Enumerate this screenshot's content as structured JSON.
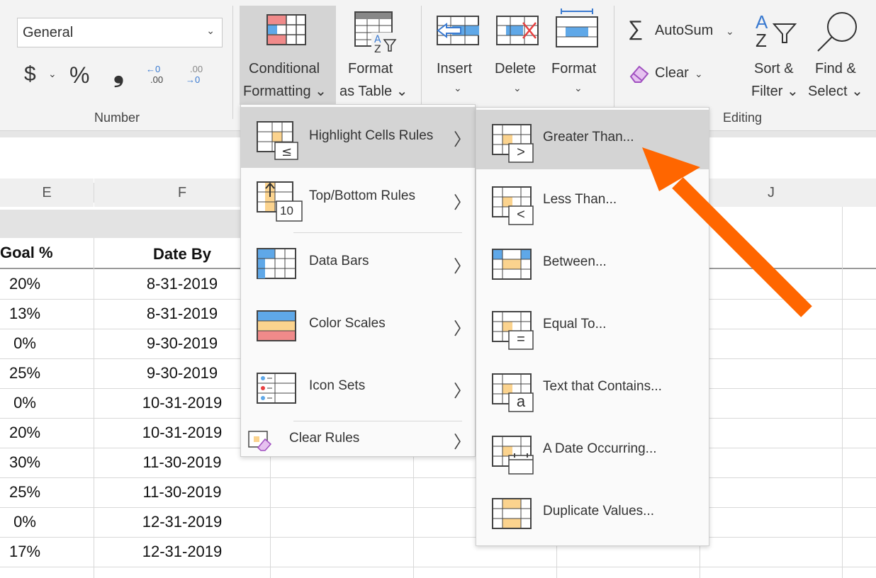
{
  "ribbon": {
    "number_format": "General",
    "currency_symbol": "$",
    "percent_symbol": "%",
    "comma_symbol": "❟",
    "inc_decimal_top": "←0",
    "inc_decimal_bottom": ".00",
    "dec_decimal_top": ".00",
    "dec_decimal_bottom": "→0",
    "number_group_label": "Number",
    "cf_label_1": "Conditional",
    "cf_label_2": "Formatting ⌄",
    "fat_label_1": "Format",
    "fat_label_2": "as Table ⌄",
    "insert_label": "Insert",
    "delete_label": "Delete",
    "format_label": "Format",
    "autosum_label": "AutoSum",
    "clear_label": "Clear",
    "sort_label_1": "Sort &",
    "sort_label_2": "Filter ⌄",
    "find_label_1": "Find &",
    "find_label_2": "Select ⌄",
    "editing_group_label": "Editing",
    "sigma": "∑",
    "az": "A",
    "za": "Z",
    "dropdown_glyph": "⌄"
  },
  "sheet": {
    "col_e": "E",
    "col_f": "F",
    "col_j": "J",
    "header_goal": "Goal %",
    "header_date": "Date By",
    "rows": [
      {
        "goal": "20%",
        "date": "8-31-2019"
      },
      {
        "goal": "13%",
        "date": "8-31-2019"
      },
      {
        "goal": "0%",
        "date": "9-30-2019"
      },
      {
        "goal": "25%",
        "date": "9-30-2019"
      },
      {
        "goal": "0%",
        "date": "10-31-2019"
      },
      {
        "goal": "20%",
        "date": "10-31-2019"
      },
      {
        "goal": "30%",
        "date": "11-30-2019"
      },
      {
        "goal": "25%",
        "date": "11-30-2019"
      },
      {
        "goal": "0%",
        "date": "12-31-2019"
      },
      {
        "goal": "17%",
        "date": "12-31-2019"
      }
    ]
  },
  "menu1": {
    "items": [
      {
        "label": "Highlight Cells Rules"
      },
      {
        "label": "Top/Bottom Rules"
      },
      {
        "label": "Data Bars"
      },
      {
        "label": "Color Scales"
      },
      {
        "label": "Icon Sets"
      },
      {
        "label": "Clear Rules"
      }
    ],
    "arrow": "〉",
    "topbottom_badge": "10"
  },
  "menu2": {
    "items": [
      {
        "label": "Greater Than..."
      },
      {
        "label": "Less Than..."
      },
      {
        "label": "Between..."
      },
      {
        "label": "Equal To..."
      },
      {
        "label": "Text that Contains..."
      },
      {
        "label": "A Date Occurring..."
      },
      {
        "label": "Duplicate Values..."
      }
    ],
    "badges": [
      ">",
      "<",
      "",
      "=",
      "a",
      "",
      ""
    ]
  },
  "colors": {
    "arrow": "#ff6600",
    "highlight": "#d4d4d4",
    "icon_yellow": "#fbd38e",
    "icon_red": "#f08a8a",
    "icon_blue": "#5fa8e8",
    "clear_purple": "#a050c0"
  }
}
